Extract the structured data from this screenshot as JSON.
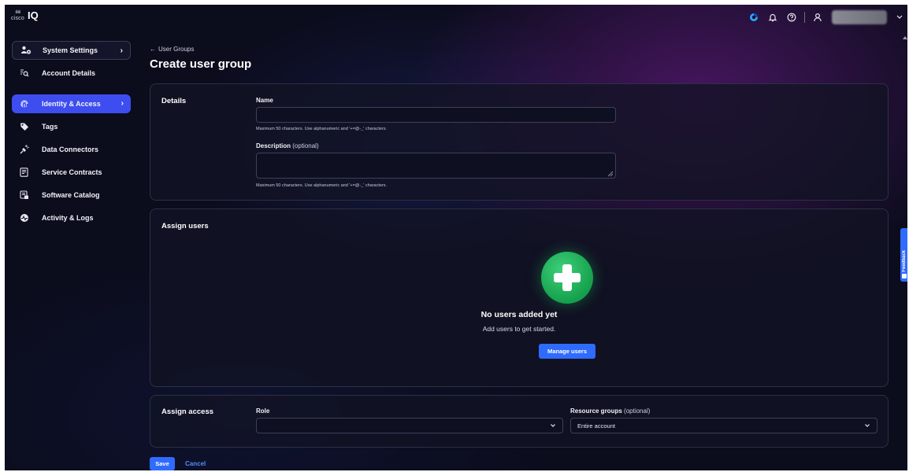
{
  "app": {
    "brand_cisco": "cisco",
    "brand_name": "IQ"
  },
  "topbar": {
    "icons": [
      "webex-icon",
      "bell-icon",
      "help-icon",
      "user-icon",
      "chevron-down-icon"
    ]
  },
  "sidebar": {
    "items": [
      {
        "label": "System Settings",
        "icon": "users-gear-icon",
        "state": "expandable"
      },
      {
        "label": "Account Details",
        "icon": "account-search-icon"
      },
      {
        "label": "Identity & Access",
        "icon": "fingerprint-icon",
        "state": "active"
      },
      {
        "label": "Tags",
        "icon": "tag-icon"
      },
      {
        "label": "Data Connectors",
        "icon": "plug-icon"
      },
      {
        "label": "Service Contracts",
        "icon": "contract-icon"
      },
      {
        "label": "Software Catalog",
        "icon": "catalog-icon"
      },
      {
        "label": "Activity & Logs",
        "icon": "activity-icon"
      }
    ]
  },
  "breadcrumb": {
    "back_label": "User Groups"
  },
  "page": {
    "title": "Create user group"
  },
  "details": {
    "title": "Details",
    "name_label": "Name",
    "name_value": "",
    "name_hint": "Maximum 50 characters. Use alphanumeric and '+=@-_' characters.",
    "description_label": "Description",
    "description_optional": "(optional)",
    "description_value": "",
    "description_hint": "Maximum 50 characters. Use alphanumeric and '+=@-_' characters."
  },
  "assign_users": {
    "title": "Assign users",
    "empty_title": "No users added yet",
    "empty_subtitle": "Add users to get started.",
    "manage_button": "Manage users"
  },
  "assign_access": {
    "title": "Assign access",
    "role_label": "Role",
    "role_value": "",
    "resource_label": "Resource groups",
    "resource_optional": "(optional)",
    "resource_value": "Entire account"
  },
  "footer": {
    "save_label": "Save",
    "cancel_label": "Cancel"
  },
  "feedback": {
    "label": "Feedback"
  },
  "colors": {
    "accent": "#3d4df0",
    "primary_button": "#2f6bff",
    "success": "#1fb45a",
    "background": "#0b0c1c"
  }
}
